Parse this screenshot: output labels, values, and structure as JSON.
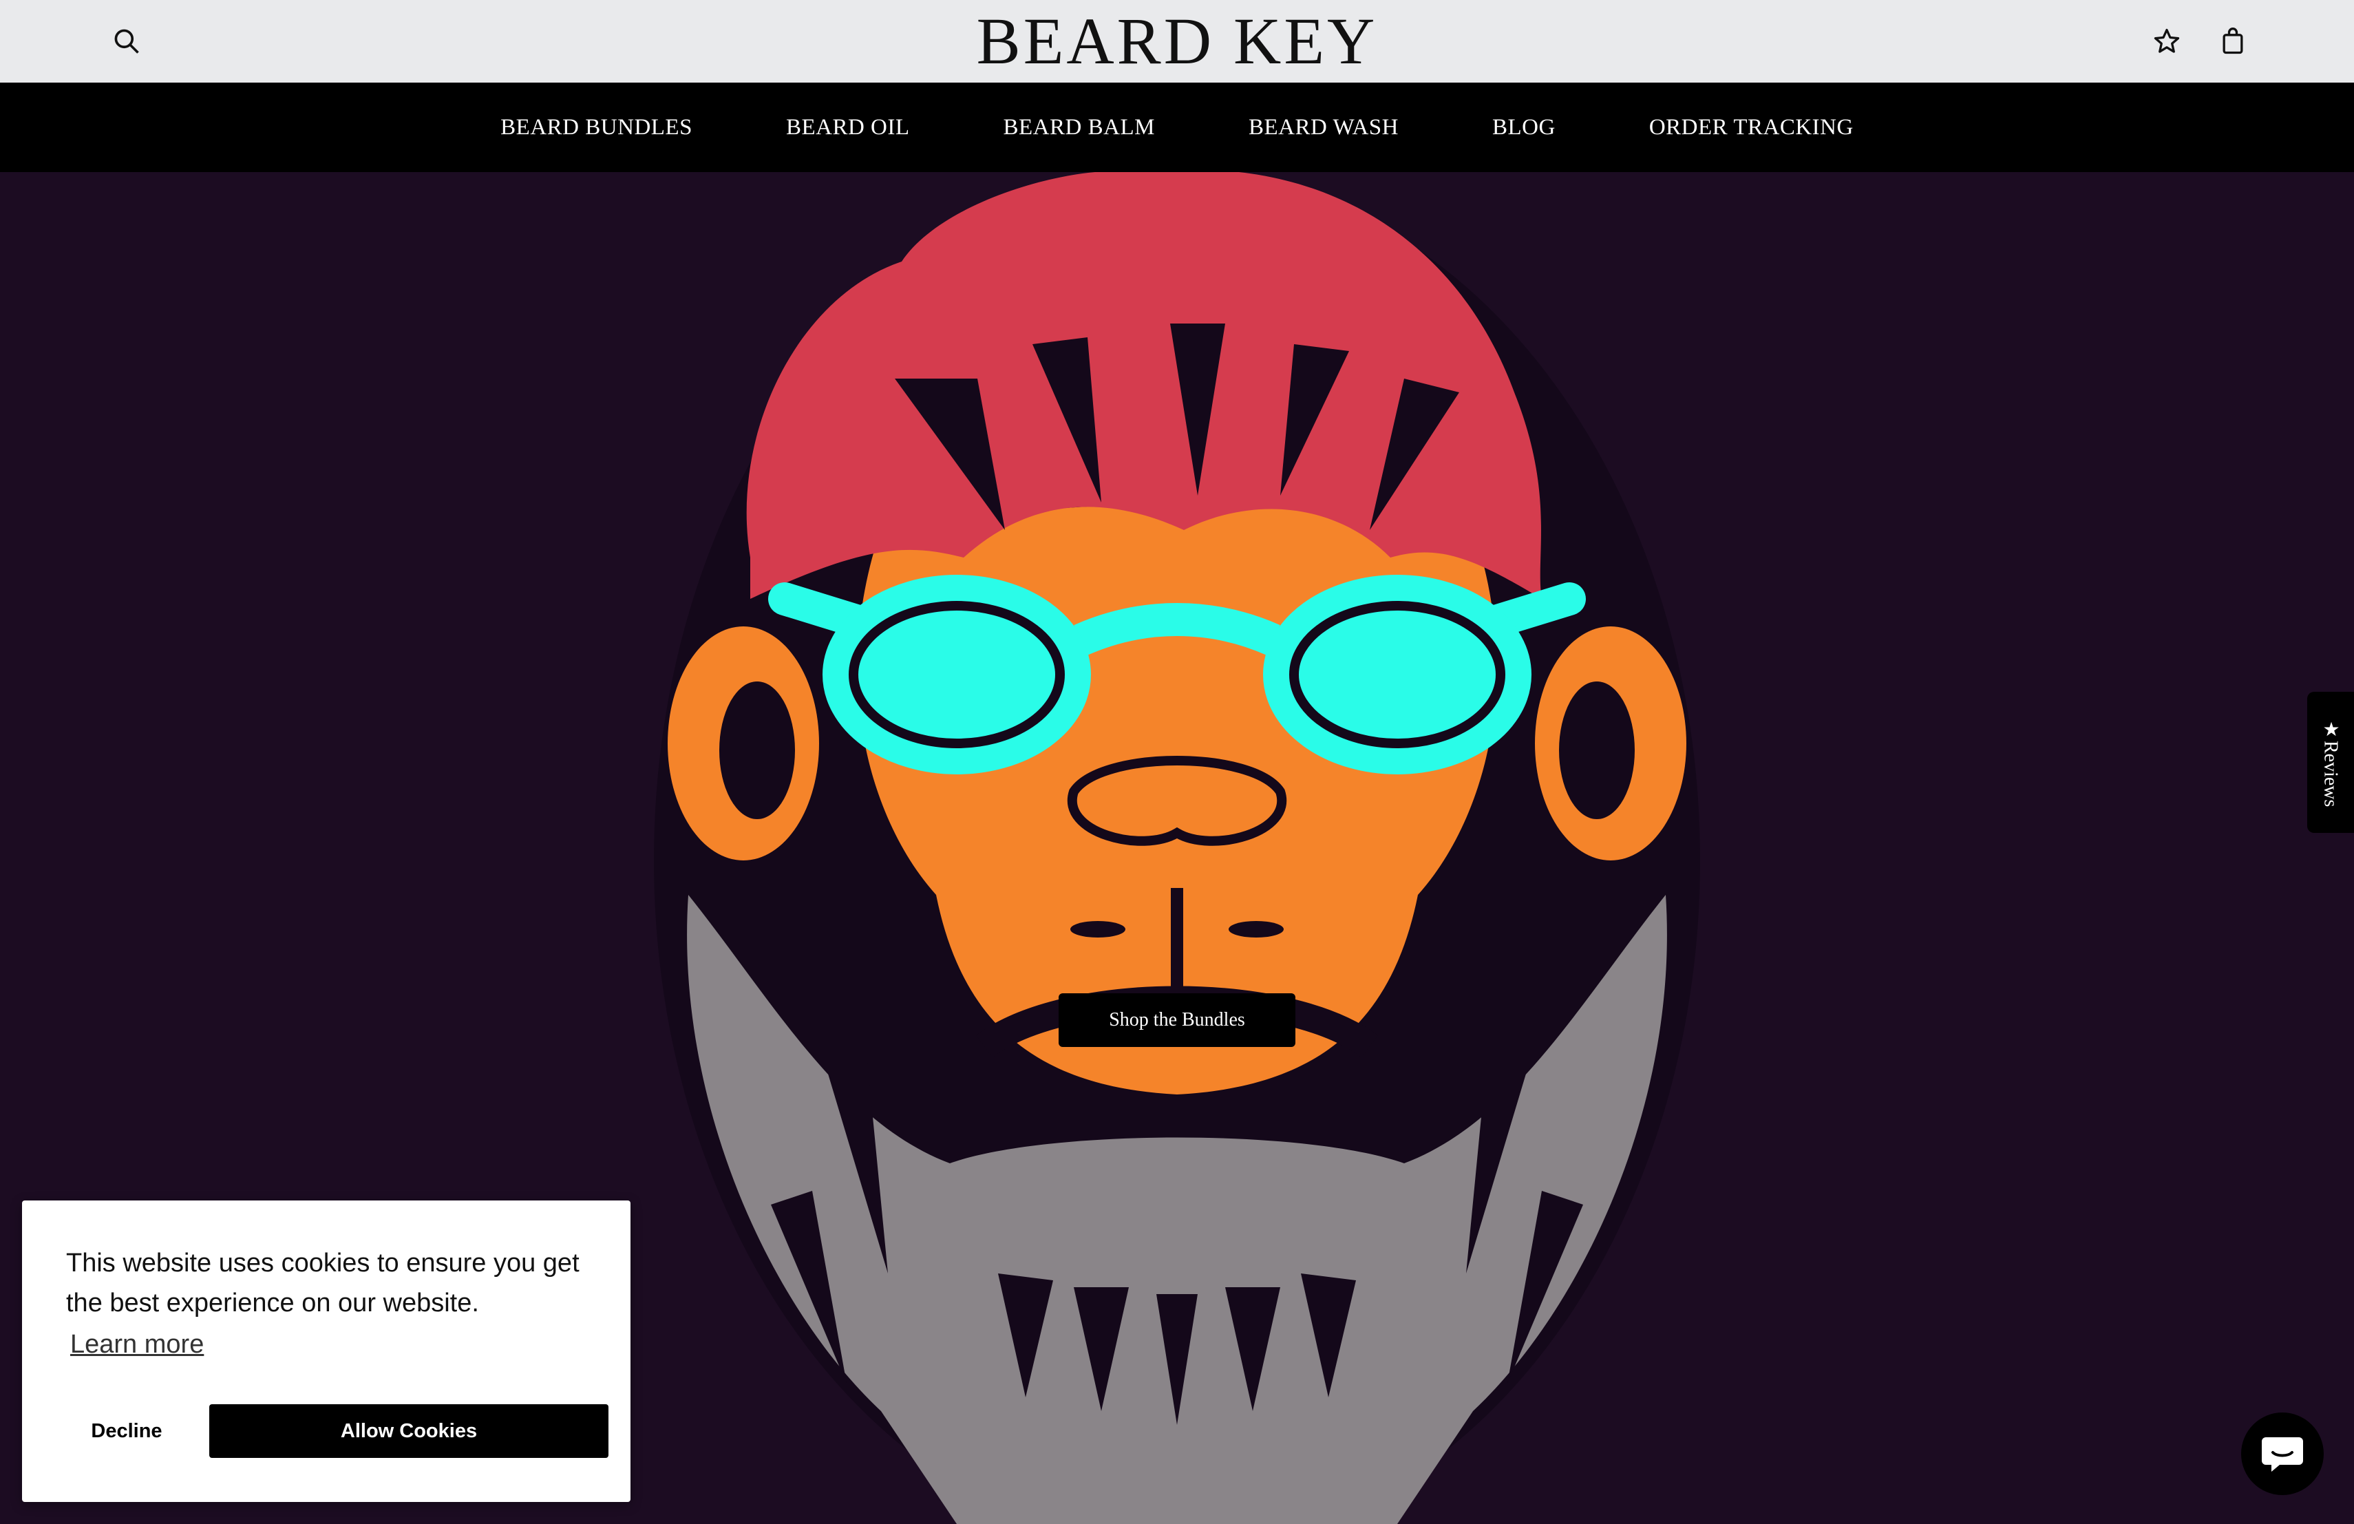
{
  "header": {
    "brand": "BEARD KEY",
    "search_icon": "search-icon",
    "wishlist_icon": "star-outline-icon",
    "cart_icon": "shopping-bag-icon"
  },
  "nav": {
    "items": [
      {
        "label": "BEARD BUNDLES"
      },
      {
        "label": "BEARD OIL"
      },
      {
        "label": "BEARD BALM"
      },
      {
        "label": "BEARD WASH"
      },
      {
        "label": "BLOG"
      },
      {
        "label": "ORDER TRACKING"
      }
    ]
  },
  "hero": {
    "cta_label": "Shop the Bundles",
    "background_color": "#1c0c22",
    "illustration": "bearded-monkey-with-cyan-glasses",
    "colors": {
      "hair": "#d53c4e",
      "face": "#f5842a",
      "glasses": "#2afce8",
      "beard": "#8a8589"
    }
  },
  "reviews_tab": {
    "label": "★Reviews"
  },
  "cookie_banner": {
    "message": "This website uses cookies to ensure you get the best experience on our website.",
    "learn_more": "Learn more",
    "decline_label": "Decline",
    "allow_label": "Allow Cookies"
  },
  "chat": {
    "icon": "chat-bubble-icon"
  }
}
